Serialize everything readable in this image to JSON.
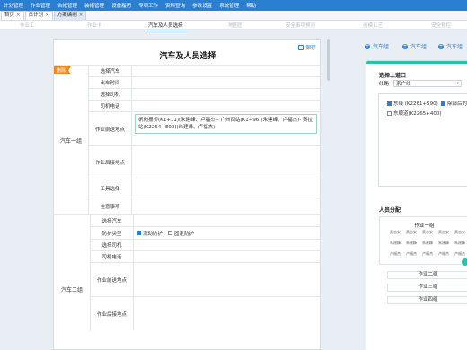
{
  "menu": [
    "计划管理",
    "作业管理",
    "台帐管理",
    "装帽管理",
    "设备履历",
    "专项工作",
    "资料查询",
    "参数设置",
    "系统管理",
    "帮助"
  ],
  "tabs": [
    {
      "label": "首页",
      "close": "×"
    },
    {
      "label": "日计划",
      "close": "×"
    },
    {
      "label": "方案编制",
      "close": "×"
    }
  ],
  "steps": [
    "作业工",
    "作业卡",
    "汽车及人员选择",
    "地图图",
    "安全事项预测",
    "创模工艺",
    "安全预控"
  ],
  "panel": {
    "title": "汽车及人员选择",
    "save": "保存",
    "delete_badge": "删除",
    "groups": [
      {
        "name": "汽车一组",
        "rows": [
          {
            "label": "选择汽车",
            "value": ""
          },
          {
            "label": "出车时间",
            "value": ""
          },
          {
            "label": "选择司机",
            "value": ""
          },
          {
            "label": "司机电话",
            "value": ""
          },
          {
            "label": "作业前送地点",
            "value": "帆岗报桥(K1+11)(朱建峰、卢福杰)- 广州西站(K1+96)(朱建峰、卢福杰)- 赛拉站(K2264+800)(朱建峰、卢福杰)"
          },
          {
            "label": "作业后接地点",
            "value": ""
          },
          {
            "label": "工具选择",
            "value": ""
          },
          {
            "label": "注意事项",
            "value": ""
          }
        ]
      },
      {
        "name": "汽车二组",
        "rows": [
          {
            "label": "选择汽车",
            "value": ""
          },
          {
            "label": "防护类型",
            "options": [
              {
                "label": "流动防护",
                "checked": true
              },
              {
                "label": "固定防护",
                "checked": false
              }
            ]
          },
          {
            "label": "选择司机",
            "value": ""
          },
          {
            "label": "司机电话",
            "value": ""
          },
          {
            "label": "作业前送地点",
            "value": ""
          },
          {
            "label": "作业后接地点",
            "value": ""
          }
        ]
      }
    ]
  },
  "right": {
    "top_buttons": [
      "汽车组",
      "汽车组",
      "汽车组"
    ],
    "select_title": "选择上道口",
    "line_label": "线路",
    "line_value": "京广线",
    "routes": [
      {
        "label": "东线 (K2261+590)",
        "checked": true
      },
      {
        "label": "除部后的",
        "checked": true
      },
      {
        "label": "东顺道(K2265+400)",
        "checked": false
      }
    ],
    "staff_title": "人员分配",
    "work_group": "作业一组",
    "cells": [
      "黄志安",
      "黄志安",
      "黄志安",
      "黄志安",
      "黄志安",
      "朱建峰",
      "朱建峰",
      "朱建峰",
      "朱建峰",
      "朱建峰",
      "卢福杰",
      "卢福杰",
      "卢福杰",
      "卢福杰",
      "卢福杰",
      "黄志安",
      "黄志安",
      "黄志安",
      "黄志安",
      "黄志安"
    ],
    "groups": [
      "作业二组",
      "作业三组",
      "作业四组"
    ]
  },
  "colors": {
    "menubar": "#2b7fd3",
    "accent": "#2fbfa6",
    "badge": "#f28a20"
  }
}
